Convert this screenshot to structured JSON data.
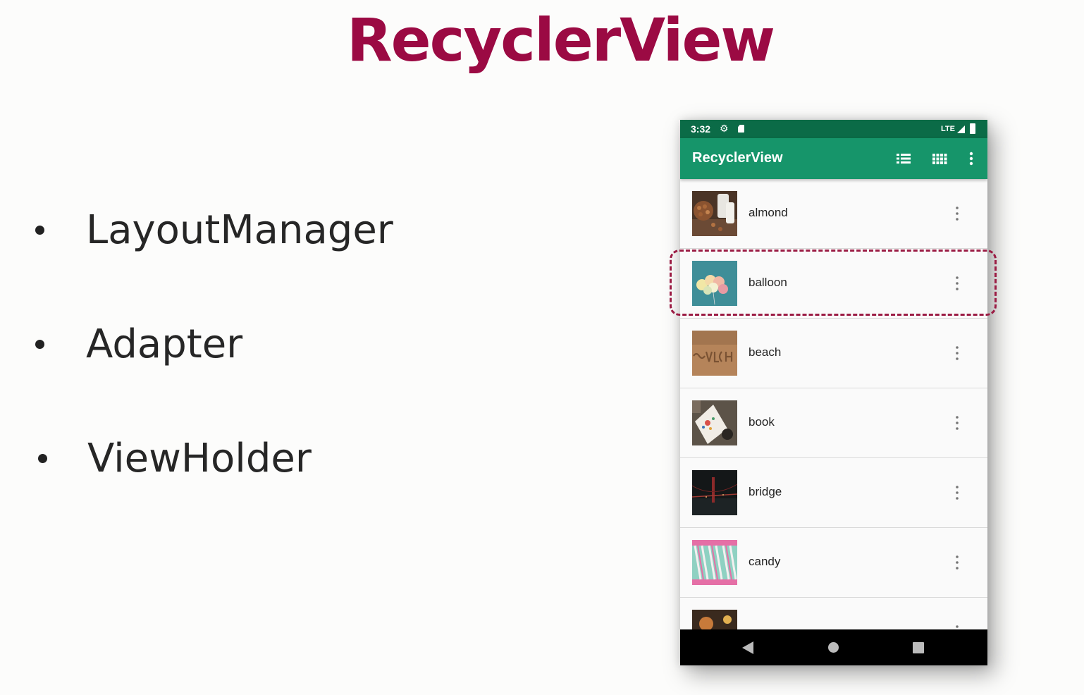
{
  "slide": {
    "title": "RecyclerView",
    "bullets": [
      "LayoutManager",
      "Adapter",
      "ViewHolder"
    ]
  },
  "phone": {
    "status_bar": {
      "time": "3:32",
      "network": "LTE",
      "icons": [
        "settings-icon",
        "sd-card-icon",
        "signal-icon",
        "battery-icon"
      ]
    },
    "app_bar": {
      "title": "RecyclerView",
      "actions": [
        "list-view-icon",
        "grid-view-icon",
        "more-vert-icon"
      ]
    },
    "list": {
      "items": [
        {
          "label": "almond",
          "image": "almond-photo"
        },
        {
          "label": "balloon",
          "image": "balloon-photo"
        },
        {
          "label": "beach",
          "image": "beach-photo"
        },
        {
          "label": "book",
          "image": "book-photo"
        },
        {
          "label": "bridge",
          "image": "bridge-photo"
        },
        {
          "label": "candy",
          "image": "candy-photo"
        }
      ],
      "highlighted_index": 1
    },
    "nav_bar": {
      "icons": [
        "back-icon",
        "home-icon",
        "recents-icon"
      ]
    }
  },
  "colors": {
    "title": "#9b0a43",
    "status_bar": "#0b6b47",
    "app_bar": "#16956a",
    "highlight_border": "#9b1c44"
  }
}
